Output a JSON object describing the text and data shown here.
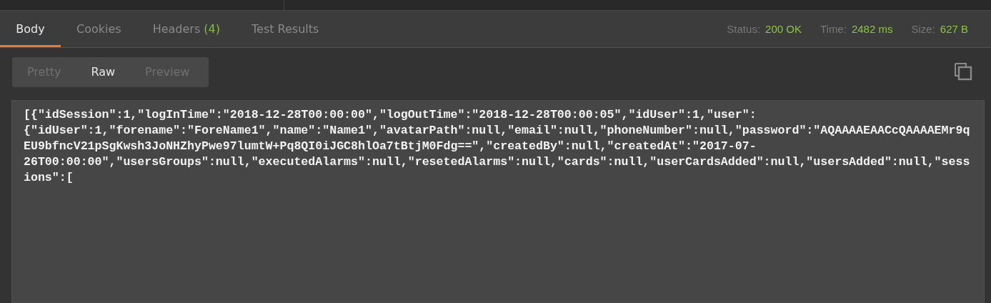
{
  "tabs": [
    {
      "label": "Body",
      "selected": true
    },
    {
      "label": "Cookies",
      "selected": false
    },
    {
      "label": "Headers",
      "count": "(4)",
      "selected": false
    },
    {
      "label": "Test Results",
      "selected": false
    }
  ],
  "stats": [
    {
      "label": "Status:",
      "value": "200 OK"
    },
    {
      "label": "Time:",
      "value": "2482 ms"
    },
    {
      "label": "Size:",
      "value": "627 B"
    }
  ],
  "view_modes": [
    {
      "label": "Pretty",
      "selected": false
    },
    {
      "label": "Raw",
      "selected": true
    },
    {
      "label": "Preview",
      "selected": false
    }
  ],
  "response_lines": [
    "[{\"idSession\":1,\"logInTime\":\"2018-12-28T00:00:00\",\"logOutTime\":\"2018-12-28T00:00:05\",\"idUser\":1,\"user\":",
    "{\"idUser\":1,\"forename\":\"ForeName1\",\"name\":\"Name1\",\"avatarPath\":null,\"email\":null,\"phoneNumber\":null,\"password\":\"AQAAAAEAACcQAAAAEMr9q",
    "EU9bfncV21pSgKwsh3JoNHZhyPwe97lumtW+Pq8QI0iJGC8hlOa7tBtjM0Fdg==\",\"createdBy\":null,\"createdAt\":\"2017-07-",
    "26T00:00:00\",\"usersGroups\":null,\"executedAlarms\":null,\"resetedAlarms\":null,\"cards\":null,\"userCardsAdded\":null,\"usersAdded\":null,\"sess",
    "ions\":["
  ]
}
